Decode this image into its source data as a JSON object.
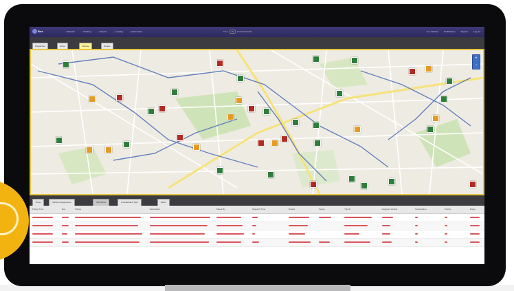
{
  "app": {
    "brand": "Bus",
    "nav_items": [
      "Dispatch",
      "Tracking",
      "Reports",
      "Locating",
      "Admin View"
    ],
    "nav_right": [
      "Live Vehicles",
      "Notifications",
      "Support",
      "Log out"
    ],
    "center_title_prefix": "Time",
    "center_title_value": "26",
    "center_title_suffix": "Arrival Schedule"
  },
  "map_tabs": [
    "Dispatched",
    "Active",
    "Vehicles",
    "Routes"
  ],
  "map_tabs_active": 2,
  "map": {
    "zoom_in": "+",
    "zoom_out": "−",
    "colors": {
      "green": "#2f7d3a",
      "red": "#b22b22",
      "orange": "#e59b22"
    }
  },
  "grid_tabs": [
    "Runs",
    "Vehicle Assignments",
    "Schedules",
    "Unscheduled Trips",
    "Alerts"
  ],
  "grid_tabs_active": 2,
  "table": {
    "columns": [
      "Pickup Time",
      "Run",
      "Pickup",
      "Destination",
      "Status By",
      "Dispatch Time",
      "Vehicle",
      "Space",
      "Trip ID",
      "Assigned Vehicle",
      "Subscription",
      "Priority",
      "Route"
    ],
    "row_count": 4
  }
}
